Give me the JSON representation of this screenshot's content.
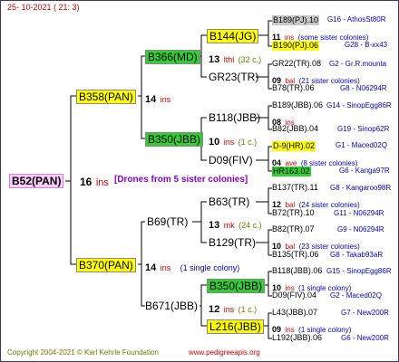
{
  "header": {
    "date": "25- 10-2021 ( 21: 3)"
  },
  "gen0": {
    "name": "B52(PAN)",
    "num": "16",
    "ins": "ins",
    "note": "[Drones from 5 sister colonies]"
  },
  "gen1": [
    {
      "name": "B358(PAN)",
      "num": "14",
      "ins": "ins"
    },
    {
      "name": "B370(PAN)",
      "num": "14",
      "ins": "ins",
      "note": "(1 single colony)"
    }
  ],
  "gen2": [
    {
      "name": "B366(MD)",
      "num": "13",
      "ins": "lthl",
      "note": "(32 c.)"
    },
    {
      "name": "B350(JBB)",
      "num": "10",
      "ins": "ins",
      "note": "(1 c.)"
    },
    {
      "name": "B69(TR)",
      "num": "13",
      "ins": "mk",
      "note": "(24 c.)"
    },
    {
      "name": "B671(JBB)",
      "num": "12",
      "ins": "ins",
      "note": "(1 c.)"
    }
  ],
  "gen3": [
    {
      "name": "B144(JG)"
    },
    {
      "name": "GR23(TR)"
    },
    {
      "name": "B118(JBB)"
    },
    {
      "name": "D09(FIV)"
    },
    {
      "name": "B63(TR)"
    },
    {
      "name": "B129(TR)"
    },
    {
      "name": "B350(JBB)"
    },
    {
      "name": "L216(JBB)"
    }
  ],
  "gen4": [
    {
      "top": "B189(PJ).10",
      "top_id": "G16 - AthosSt80R",
      "num": "11",
      "ins": "ins",
      "note": "(some sister colonies)",
      "bot": "B190(PJ).06",
      "bot_id": "G28 - B-xx43"
    },
    {
      "top": "GR22(TR).08",
      "top_id": "G2 - Gr.R.mounta",
      "num": "09",
      "ins": "bal",
      "note": "(21 sister colonies)",
      "bot": "B78(TR).06",
      "bot_id": "G8 - N06294R"
    },
    {
      "top": "B189(JBB).06",
      "top_id": "G14 - SinopEgg86R",
      "num": "08",
      "ins": "ins",
      "note": "",
      "bot": "B82(JBB).04",
      "bot_id": "G19 - Sinop62R"
    },
    {
      "top": "D-9(HR).02",
      "top_id": "G1 - Maced02Q",
      "num": "04",
      "ins": "ave",
      "note": "(8 sister colonies)",
      "bot": "HR163.02",
      "bot_id": "G6 - Kanga97R"
    },
    {
      "top": "B137(TR).11",
      "top_id": "G8 - Kangaroo98R",
      "num": "12",
      "ins": "bal",
      "note": "(24 sister colonies)",
      "bot": "B72(TR).10",
      "bot_id": "G11 - N06294R"
    },
    {
      "top": "B82(TR).07",
      "top_id": "G9 - N06294R",
      "num": "10",
      "ins": "bal",
      "note": "(23 sister colonies)",
      "bot": "B135(TR).06",
      "bot_id": "G8 - Takab93aR"
    },
    {
      "top": "B118(JBB).06",
      "top_id": "G15 - SinopEgg86R",
      "num": "10",
      "ins": "ins",
      "note": "(1 single colony)",
      "bot": "D09(FIV).04",
      "bot_id": "G2 - Maced02Q"
    },
    {
      "top": "L43(JBB).07",
      "top_id": "G7 - New200R",
      "num": "09",
      "ins": "ins",
      "note": "(1 single colony)",
      "bot": "L192(JBB).06",
      "bot_id": "G6 - New200R"
    }
  ],
  "footer": {
    "copyright": "Copyright 2004-2021 © Karl Kehrle Foundation",
    "url": "www.pedigreeapis.org"
  },
  "colors": {
    "yellow": "#ffff00",
    "green": "#33cc33",
    "pink": "#ffccff",
    "red": "#cc0000",
    "blue": "#0000cc",
    "olive": "#777700"
  }
}
